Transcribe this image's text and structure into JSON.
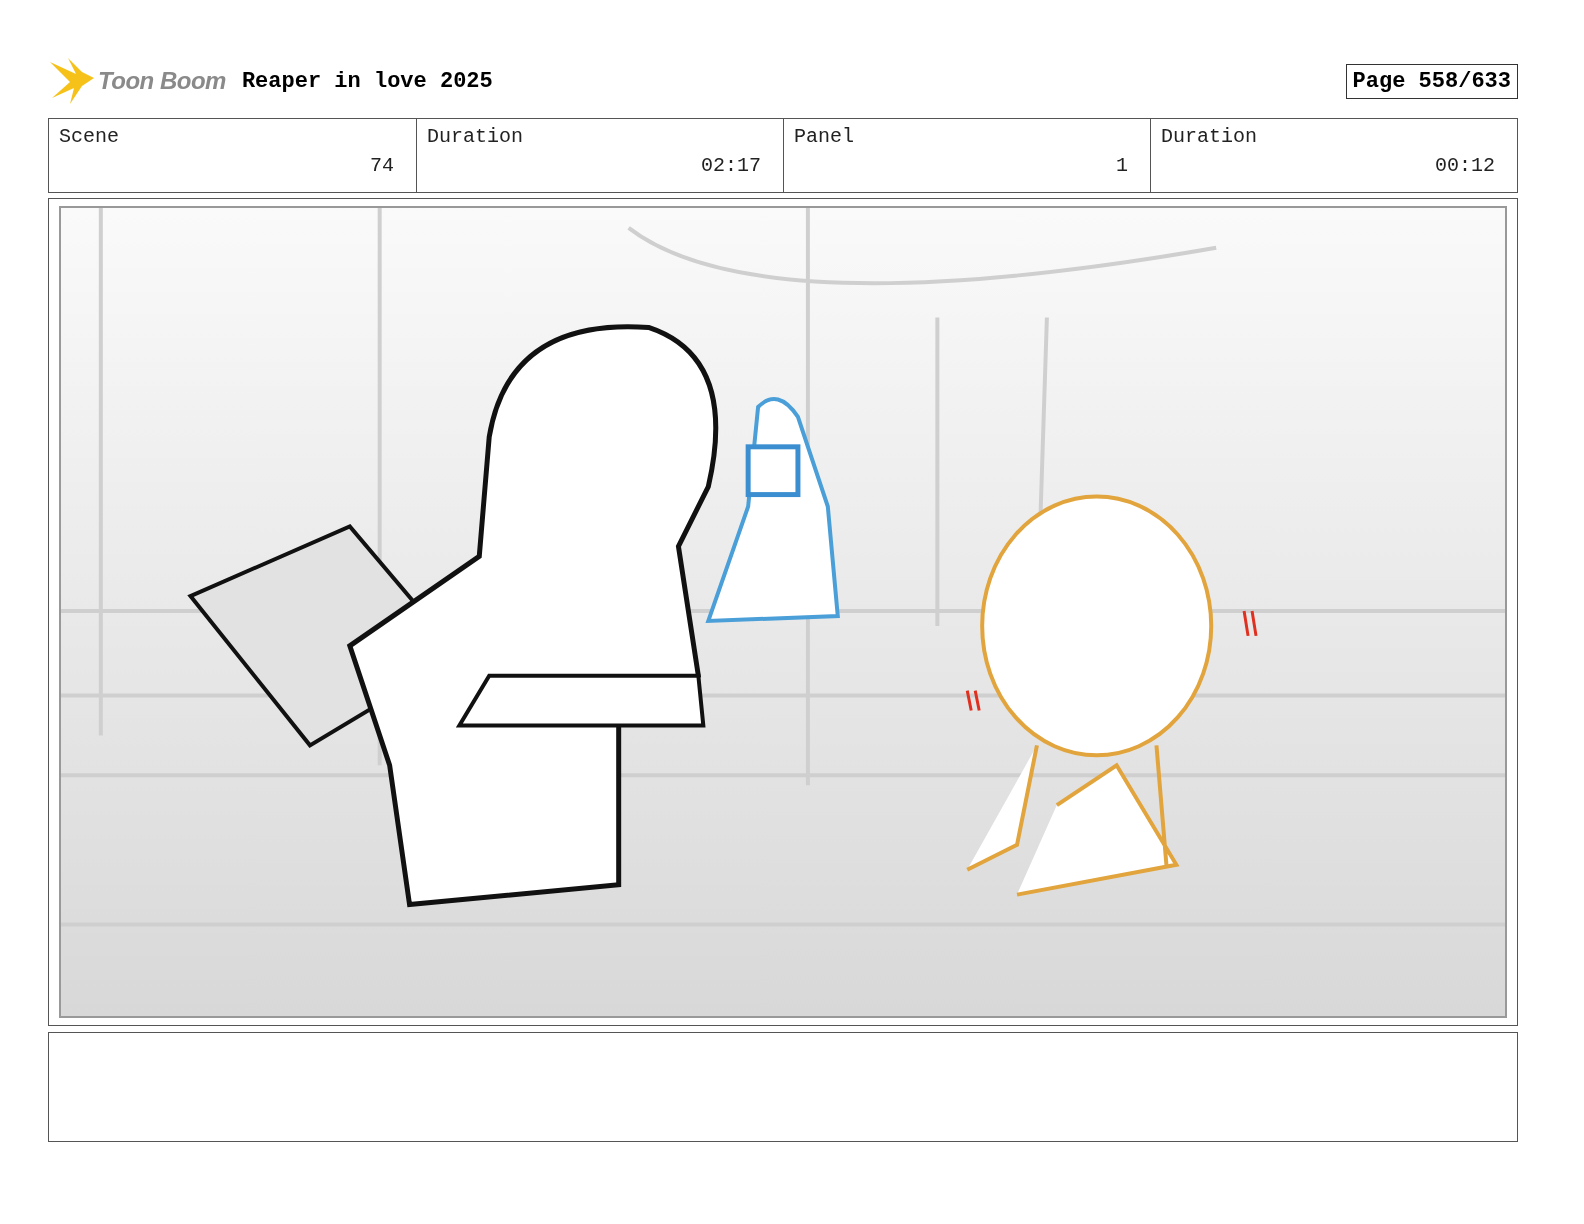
{
  "header": {
    "logo": "Toon Boom",
    "title": "Reaper in love 2025",
    "page": "Page 558/633"
  },
  "fields": [
    {
      "label": "Scene",
      "value": "74"
    },
    {
      "label": "Duration",
      "value": "02:17"
    },
    {
      "label": "Panel",
      "value": "1"
    },
    {
      "label": "Duration",
      "value": "00:12"
    }
  ]
}
